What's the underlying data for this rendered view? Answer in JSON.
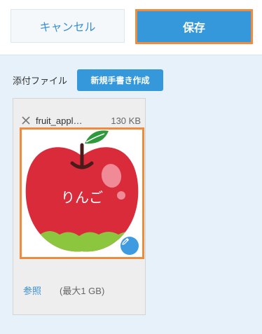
{
  "toolbar": {
    "cancel_label": "キャンセル",
    "save_label": "保存"
  },
  "attachments": {
    "label": "添付ファイル",
    "new_button_label": "新規手書き作成",
    "file": {
      "name": "fruit_appl…",
      "size": "130 KB",
      "thumbnail_text": "りんご"
    },
    "browse_label": "参照",
    "limit_text": "(最大1 GB)"
  },
  "colors": {
    "accent": "#3498db",
    "highlight": "#f08a3c",
    "apple_red": "#d92b3a",
    "leaf_green": "#2e9a3c",
    "apple_bottom_green": "#8cc63f"
  },
  "icons": {
    "close": "close-icon",
    "edit": "pencil-icon"
  }
}
